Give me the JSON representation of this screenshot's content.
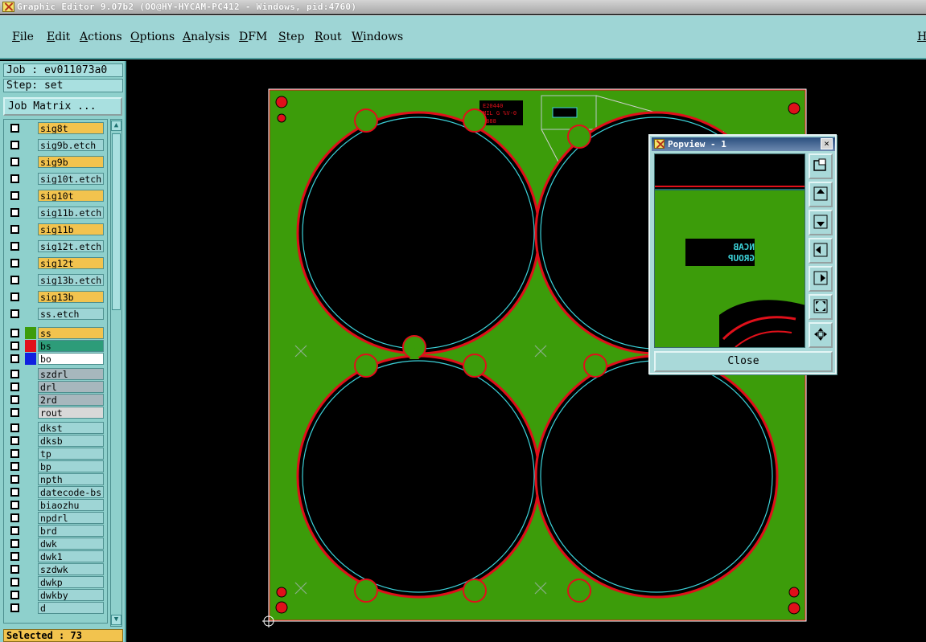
{
  "window": {
    "title": "Graphic Editor 9.07b2 (OO@HY-HYCAM-PC412 - Windows, pid:4760)"
  },
  "menu": [
    "File",
    "Edit",
    "Actions",
    "Options",
    "Analysis",
    "DFM",
    "Step",
    "Rout",
    "Windows"
  ],
  "menu_right": "H",
  "left_panel": {
    "job": "Job : ev011073a0",
    "step": "Step: set",
    "job_matrix_button": "Job Matrix ...",
    "layers": [
      {
        "name": "sig8t",
        "color": "#f2c34e"
      },
      {
        "name": "sig9b.etch",
        "color": "#9ed5d5"
      },
      {
        "name": "sig9b",
        "color": "#f2c34e"
      },
      {
        "name": "sig10t.etch",
        "color": "#9ed5d5"
      },
      {
        "name": "sig10t",
        "color": "#f2c34e"
      },
      {
        "name": "sig11b.etch",
        "color": "#9ed5d5"
      },
      {
        "name": "sig11b",
        "color": "#f2c34e"
      },
      {
        "name": "sig12t.etch",
        "color": "#9ed5d5"
      },
      {
        "name": "sig12t",
        "color": "#f2c34e"
      },
      {
        "name": "sig13b.etch",
        "color": "#9ed5d5"
      },
      {
        "name": "sig13b",
        "color": "#f2c34e"
      },
      {
        "name": "ss.etch",
        "color": "#9ed5d5"
      },
      {
        "name": "ss",
        "color": "#f2c34e"
      },
      {
        "name": "bs",
        "color": "#2d9c79"
      },
      {
        "name": "bo",
        "color": "#ffffff"
      },
      {
        "name": "szdrl",
        "color": "#a7b7bd"
      },
      {
        "name": "drl",
        "color": "#a7b7bd"
      },
      {
        "name": "2rd",
        "color": "#a7b7bd"
      },
      {
        "name": "rout",
        "color": "#d8d8d8"
      },
      {
        "name": "dkst",
        "color": "#9ed5d5"
      },
      {
        "name": "dksb",
        "color": "#9ed5d5"
      },
      {
        "name": "tp",
        "color": "#9ed5d5"
      },
      {
        "name": "bp",
        "color": "#9ed5d5"
      },
      {
        "name": "npth",
        "color": "#9ed5d5"
      },
      {
        "name": "datecode-bs",
        "color": "#9ed5d5"
      },
      {
        "name": "biaozhu",
        "color": "#9ed5d5"
      },
      {
        "name": "npdrl",
        "color": "#9ed5d5"
      },
      {
        "name": "brd",
        "color": "#9ed5d5"
      },
      {
        "name": "dwk",
        "color": "#9ed5d5"
      },
      {
        "name": "dwk1",
        "color": "#9ed5d5"
      },
      {
        "name": "szdwk",
        "color": "#9ed5d5"
      },
      {
        "name": "dwkp",
        "color": "#9ed5d5"
      },
      {
        "name": "dwkby",
        "color": "#9ed5d5"
      },
      {
        "name": "d",
        "color": "#9ed5d5"
      }
    ],
    "selected": "Selected : 73"
  },
  "board": {
    "label_text": "E20440 MIL G %V-0 8888"
  },
  "popview": {
    "title": "Popview - 1",
    "close_button": "Close",
    "close_x": "×",
    "preview_text": "NCAB GROUP",
    "tools": [
      "zoom-window-icon",
      "pan-up-icon",
      "pan-down-icon",
      "pan-left-icon",
      "pan-right-icon",
      "fit-screen-icon",
      "zoom-extents-icon"
    ]
  },
  "colors": {
    "board_green": "#3c9c0a",
    "outline_cyan": "#3cd1d8",
    "route_red": "#e0101a",
    "panel_teal": "#8ed0cc"
  }
}
